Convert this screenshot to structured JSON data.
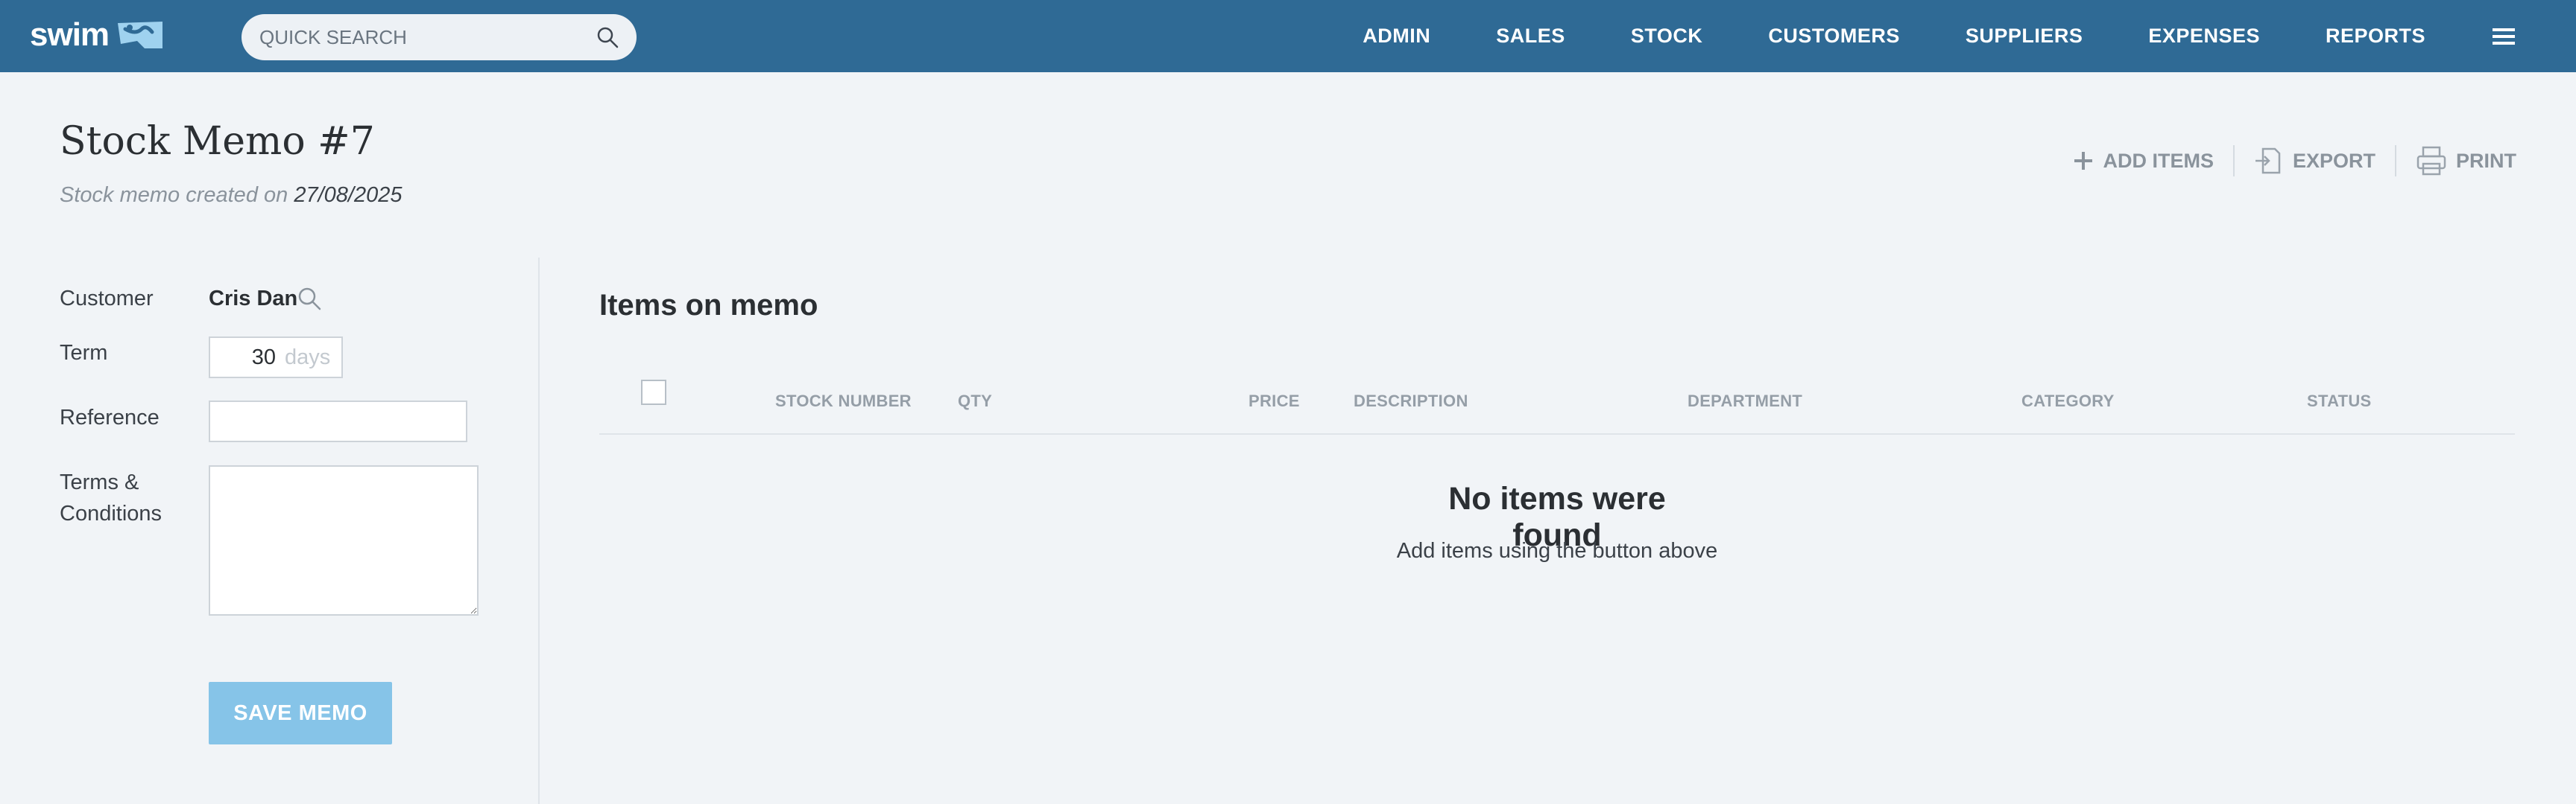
{
  "app": {
    "logo_text": "swim",
    "search_placeholder": "QUICK SEARCH"
  },
  "nav": {
    "items": [
      "ADMIN",
      "SALES",
      "STOCK",
      "CUSTOMERS",
      "SUPPLIERS",
      "EXPENSES",
      "REPORTS"
    ]
  },
  "header": {
    "title": "Stock Memo #7",
    "subtitle_prefix": "Stock memo created on",
    "created_date": "27/08/2025"
  },
  "actions": {
    "add_items": "ADD ITEMS",
    "export": "EXPORT",
    "print": "PRINT"
  },
  "form": {
    "customer_label": "Customer",
    "customer_value": "Cris Dan",
    "term_label": "Term",
    "term_value": "30",
    "term_unit": "days",
    "reference_label": "Reference",
    "reference_value": "",
    "terms_label_line1": "Terms &",
    "terms_label_line2": "Conditions",
    "terms_value": "",
    "save_label": "SAVE MEMO"
  },
  "items": {
    "title": "Items on memo",
    "columns": [
      "STOCK NUMBER",
      "QTY",
      "PRICE",
      "DESCRIPTION",
      "DEPARTMENT",
      "CATEGORY",
      "STATUS"
    ],
    "empty_title": "No items were found",
    "empty_subtitle": "Add items using the button above"
  },
  "colors": {
    "topbar": "#2f6a95",
    "background": "#f1f4f7",
    "save_button": "#86c4e8",
    "muted_text": "#8a939c"
  }
}
